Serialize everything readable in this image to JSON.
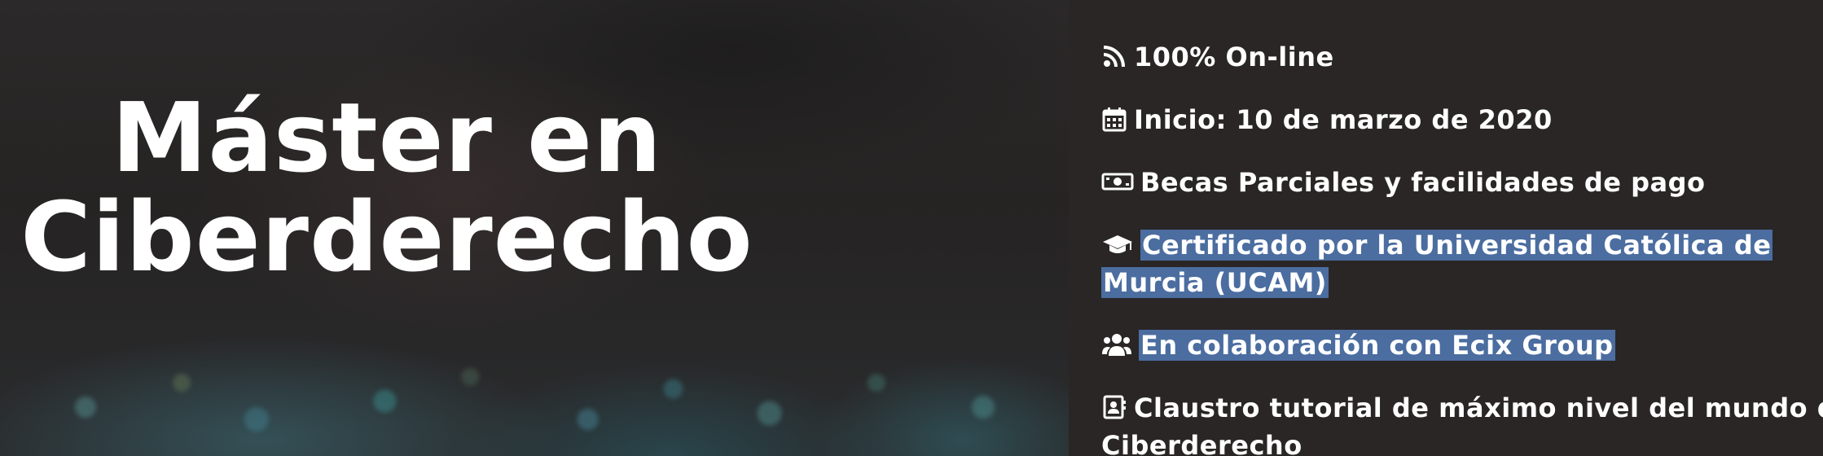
{
  "hero": {
    "title_line1": "Máster en",
    "title_line2": "Ciberderecho"
  },
  "features": {
    "online": {
      "icon": "rss-icon",
      "text": "100% On-line"
    },
    "start": {
      "icon": "calendar-icon",
      "text": "Inicio: 10 de marzo de 2020"
    },
    "scholarships": {
      "icon": "money-bill-icon",
      "text": "Becas Parciales y facilidades de pago"
    },
    "certificate": {
      "icon": "graduation-cap-icon",
      "line1": "Certificado por la Universidad Católica de",
      "line2": "Murcia (UCAM)"
    },
    "collaboration": {
      "icon": "users-icon",
      "text": "En colaboración con Ecix Group"
    },
    "faculty": {
      "icon": "address-card-icon",
      "line1": "Claustro tutorial de máximo nivel del mundo del",
      "line2": "Ciberderecho"
    }
  },
  "colors": {
    "background": "#2a2626",
    "text": "#ffffff",
    "selection_highlight": "#4b6da0"
  }
}
